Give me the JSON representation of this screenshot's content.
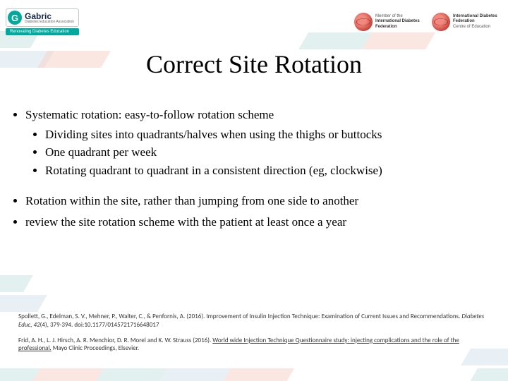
{
  "header": {
    "brand_letter": "G",
    "brand_name": "Gabric",
    "brand_sub": "Diabetes Education Association",
    "brand_tagline": "Renovating Diabetes Education",
    "idf_member_prefix": "Member of the",
    "idf_member_name": "International Diabetes Federation",
    "idf_centre_name": "International Diabetes Federation",
    "idf_centre_sub": "Centre of Education"
  },
  "title": "Correct Site Rotation",
  "bullets": {
    "b1": "Systematic rotation: easy-to-follow rotation scheme",
    "b1a": "Dividing sites into quadrants/halves when using the thighs or buttocks",
    "b1b": "One quadrant per week",
    "b1c": "Rotating quadrant to quadrant in a consistent direction (eg, clockwise)",
    "b2": "Rotation within the site, rather than jumping from one side to another",
    "b3": "review the site rotation scheme with the patient at least once a year"
  },
  "refs": {
    "r1_authors": "Spollett, G., Edelman, S. V., Mehner, P., Walter, C., & Penfornis, A. (2016). Improvement of Insulin Injection Technique: Examination of Current Issues and Recommendations. ",
    "r1_journal": "Diabetes Educ, 42",
    "r1_tail": "(4), 379-394. doi:10.1177/0145721716648017",
    "r2_authors": "Frid, A. H., L. J. Hirsch, A. R. Menchior, D. R. Morel and K. W. Strauss (2016). ",
    "r2_title": "World wide Injection Technique Questionnaire study: injecting complications and the role of the professional.",
    "r2_tail": " Mayo Clinic Proceedings, Elsevier."
  }
}
